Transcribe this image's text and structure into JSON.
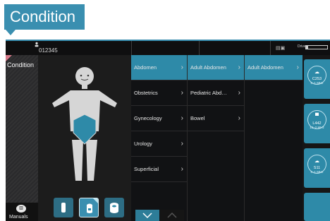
{
  "callout": {
    "label": "Condition"
  },
  "topbar": {
    "patient_id": "012345",
    "drive_label": "Drive",
    "drive_fill_fraction": 0.1
  },
  "sidebar": {
    "title": "Condition",
    "manuals_label": "Manuals",
    "manuals_icon": "book-icon"
  },
  "body_area": {
    "region_highlight_color": "#2e8aa8",
    "probe_buttons": [
      {
        "icon": "linear-probe-icon",
        "selected": false
      },
      {
        "icon": "convex-probe-icon",
        "selected": true
      },
      {
        "icon": "endocavity-probe-icon",
        "selected": false
      }
    ]
  },
  "menu": {
    "column1": [
      {
        "label": "Abdomen",
        "selected": true
      },
      {
        "label": "Obstetrics",
        "selected": false
      },
      {
        "label": "Gynecology",
        "selected": false
      },
      {
        "label": "Urology",
        "selected": false
      },
      {
        "label": "Superficial",
        "selected": false
      }
    ],
    "column2": [
      {
        "label": "Adult Abdomen",
        "selected": true
      },
      {
        "label": "Pediatric Abd…",
        "selected": false
      },
      {
        "label": "Bowel",
        "selected": false
      }
    ],
    "column3": [
      {
        "label": "Adult Abdomen",
        "selected": true
      }
    ],
    "scroll_down_icon": "chevron-down-icon",
    "scroll_up_icon": "chevron-up-icon"
  },
  "probes": [
    {
      "code": "C253",
      "freq": "5–1 MHz",
      "icon": "convex-probe-icon"
    },
    {
      "code": "L442",
      "freq": "12–2 MHz",
      "icon": "linear-probe-icon"
    },
    {
      "code": "S11",
      "freq": "5–1 MHz",
      "icon": "sector-probe-icon"
    },
    {
      "code": "",
      "freq": "",
      "icon": ""
    }
  ],
  "colors": {
    "accent": "#2e8aa8",
    "callout": "#3a8fb0",
    "sidebar_corner": "#d77a8a"
  }
}
